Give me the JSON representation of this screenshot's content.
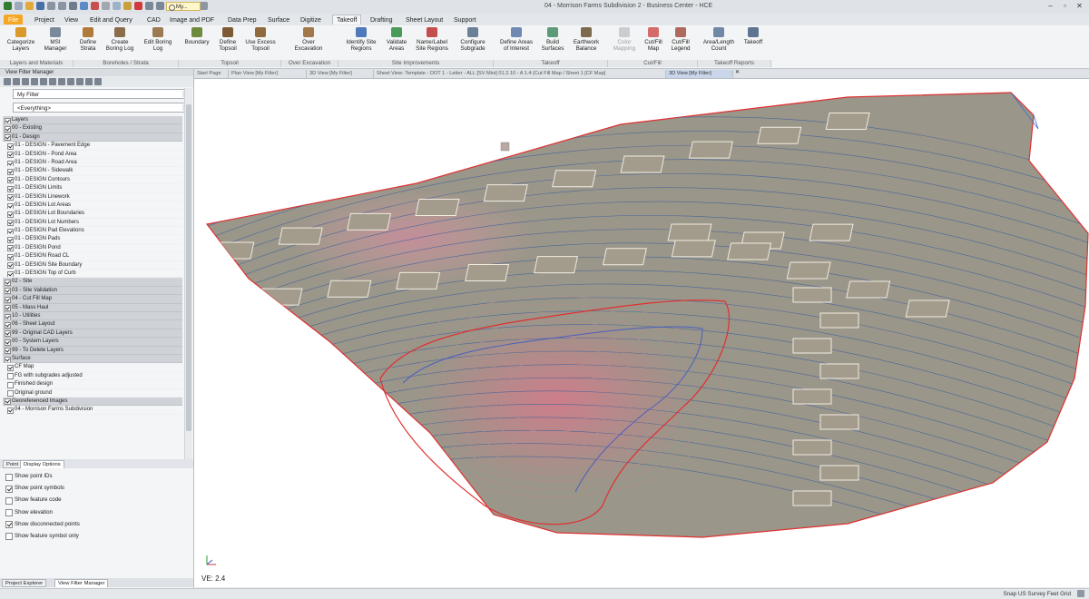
{
  "window": {
    "title": "04 - Morrison Farms Subdivision 2 - Business Center - HCE",
    "quick_access_search": "My..."
  },
  "ribbon": {
    "tabs": [
      "File",
      "Project",
      "View",
      "Edit and Query",
      "CAD",
      "Image and PDF",
      "Data Prep",
      "Surface",
      "Digitize",
      "Takeoff",
      "Drafting",
      "Sheet Layout",
      "Support"
    ],
    "active_tab": "Takeoff",
    "buttons": {
      "categorize_layers": "Categorize\nLayers",
      "msi_manager": "MSI\nManager",
      "define_strata": "Define\nStrata",
      "create_boring_log": "Create\nBoring Log",
      "edit_boring_log": "Edit Boring\nLog",
      "boundary": "Boundary",
      "define_topsoil": "Define\nTopsoil",
      "use_excess_topsoil": "Use Excess\nTopsoil",
      "over_excavation": "Over\nExcavation",
      "identify_site_regions": "Identify Site\nRegions",
      "validate_areas": "Validate\nAreas",
      "name_label_site_regions": "Name/Label\nSite Regions",
      "configure_subgrade": "Configure\nSubgrade",
      "define_areas_of_interest": "Define Areas\nof Interest",
      "build_surfaces": "Build\nSurfaces",
      "earthwork_balance": "Earthwork\nBalance",
      "color_mapping": "Color\nMapping",
      "cut_fill_map": "Cut/Fill\nMap",
      "cut_fill_legend": "Cut/Fill\nLegend",
      "area_length_count": "Area/Length\nCount",
      "takeoff": "Takeoff"
    },
    "groups": {
      "layers_and_materials": "Layers and Materials",
      "boreholes_strata": "Boreholes / Strata",
      "topsoil": "Topsoil",
      "over_excavation": "Over Excavation",
      "site_improvements": "Site Improvements",
      "takeoff": "Takeoff",
      "cut_fill": "Cut/Fill",
      "takeoff_reports": "Takeoff Reports"
    }
  },
  "document_tabs": [
    "Start Page",
    "Plan View [My Filter]",
    "3D View [My Filter]",
    "Sheet View: Template - DOT 1 - Letter - ALL [SV Mini] 01.2.10 - A 1.4 (Cut Fill Map / Sheet 1 [CF Map]",
    "3D View [My Filter]"
  ],
  "left_panel": {
    "header": "View Filter Manager",
    "filter_name": "My Filter",
    "filter_scope": "<Everything>",
    "layer_groups": [
      {
        "label": "Layers",
        "header": true
      },
      {
        "label": "00 - Existing",
        "header": true
      },
      {
        "label": "01 - Design",
        "header": true
      },
      {
        "label": "01 - DESIGN - Pavement Edge",
        "checked": true
      },
      {
        "label": "01 - DESIGN - Pond Area",
        "checked": true
      },
      {
        "label": "01 - DESIGN - Road Area",
        "checked": true
      },
      {
        "label": "01 - DESIGN - Sidewalk",
        "checked": true
      },
      {
        "label": "01 - DESIGN Contours",
        "checked": true
      },
      {
        "label": "01 - DESIGN Limits",
        "checked": true
      },
      {
        "label": "01 - DESIGN Linework",
        "checked": true
      },
      {
        "label": "01 - DESIGN Lot Areas",
        "checked": true
      },
      {
        "label": "01 - DESIGN Lot Boundaries",
        "checked": true
      },
      {
        "label": "01 - DESIGN Lot Numbers",
        "checked": true
      },
      {
        "label": "01 - DESIGN Pad Elevations",
        "checked": true
      },
      {
        "label": "01 - DESIGN Pads",
        "checked": true
      },
      {
        "label": "01 - DESIGN Pond",
        "checked": true
      },
      {
        "label": "01 - DESIGN Road CL",
        "checked": true
      },
      {
        "label": "01 - DESIGN Site Boundary",
        "checked": true
      },
      {
        "label": "01 - DESIGN Top of Curb",
        "checked": true
      },
      {
        "label": "02 - Site",
        "header": true
      },
      {
        "label": "03 - Site Validation",
        "header": true
      },
      {
        "label": "04 - Cut Fill Map",
        "header": true
      },
      {
        "label": "05 - Mass Haul",
        "header": true
      },
      {
        "label": "10 - Utilities",
        "header": true
      },
      {
        "label": "06 - Sheet Layout",
        "header": true
      },
      {
        "label": "99 - Original CAD Layers",
        "header": true
      },
      {
        "label": "00 - System Layers",
        "header": true
      },
      {
        "label": "99 - To Delete Layers",
        "header": true
      },
      {
        "label": "Surface",
        "header": true
      },
      {
        "label": "CF Map",
        "checked": true
      },
      {
        "label": "FG with subgrades adjusted",
        "checked": false
      },
      {
        "label": "Finished design",
        "checked": false
      },
      {
        "label": "Original ground",
        "checked": false
      },
      {
        "label": "Georeferenced Images",
        "header": true
      },
      {
        "label": "04 - Morrison Farms Subdivision",
        "checked": true
      }
    ],
    "lower_tabs": [
      "Point",
      "Display Options"
    ],
    "point_options": [
      {
        "label": "Show point IDs",
        "checked": false
      },
      {
        "label": "Show point symbols",
        "checked": true
      },
      {
        "label": "Show feature code",
        "checked": false
      },
      {
        "label": "Show elevation",
        "checked": false
      },
      {
        "label": "Show disconnected points",
        "checked": true
      },
      {
        "label": "Show feature symbol only",
        "checked": false
      }
    ],
    "bottom_tabs": [
      "Project Explorer",
      "View Filter Manager"
    ]
  },
  "viewport": {
    "vertical_exaggeration": "VE: 2.4"
  },
  "statusbar": {
    "text": "Snap  US Survey  Feet  Grid"
  },
  "colors": {
    "accent_file": "#f5a623",
    "surface": "#9a9689",
    "site_boundary": "#e03030",
    "contours": "#3d5f9e",
    "fill_area": "#d67a8a"
  }
}
